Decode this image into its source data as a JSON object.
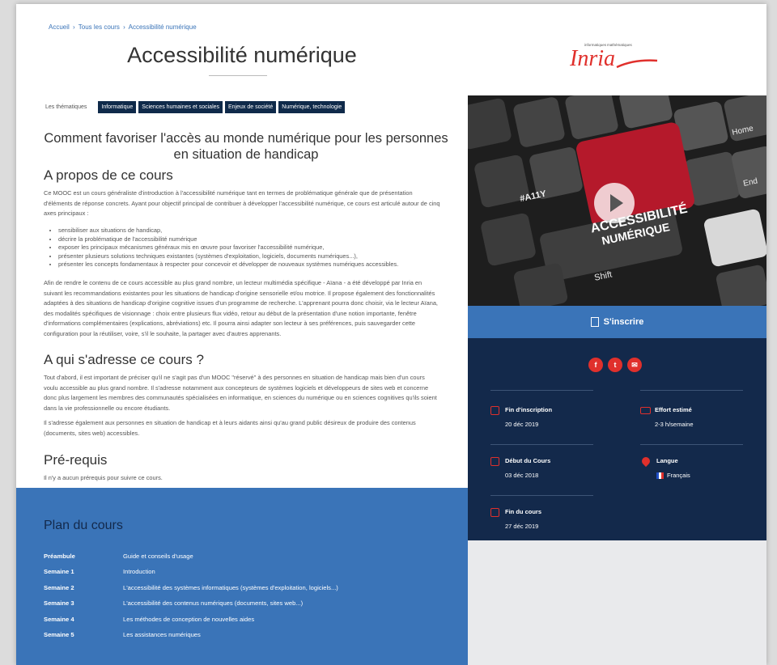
{
  "breadcrumb": {
    "home": "Accueil",
    "all_courses": "Tous les cours",
    "current": "Accessibilité numérique",
    "sep": "›"
  },
  "page_title": "Accessibilité numérique",
  "themes": {
    "label": "Les thématiques",
    "tags": [
      "Informatique",
      "Sciences humaines et sociales",
      "Enjeux de société",
      "Numérique, technologie"
    ]
  },
  "subtitle": "Comment favoriser l'accès au monde numérique pour les personnes en situation de handicap",
  "about": {
    "heading": "A propos de ce cours",
    "intro": "Ce MOOC est un cours généraliste d'introduction à l'accessibilité numérique tant en termes de problématique générale que de présentation d'éléments de réponse concrets. Ayant pour objectif principal de contribuer à développer l'accessibilité numérique, ce cours est articulé autour de cinq axes principaux :",
    "bullets": [
      "sensibiliser aux situations de handicap,",
      "décrire la problématique de l'accessibilité numérique",
      "exposer les principaux mécanismes généraux mis en œuvre pour favoriser l'accessibilité numérique,",
      "présenter plusieurs solutions techniques existantes (systèmes d'exploitation, logiciels, documents numériques...),",
      "présenter les concepts fondamentaux à respecter pour concevoir et développer de nouveaux systèmes numériques accessibles."
    ],
    "body": "Afin de rendre le contenu de ce cours accessible au plus grand nombre, un lecteur multimédia spécifique - Aïana - a été développé par Inria en suivant les recommandations existantes pour les situations de handicap d'origine sensorielle et/ou motrice. Il propose également des fonctionnalités adaptées à des situations de handicap d'origine cognitive issues d'un programme de recherche. L'apprenant pourra donc choisir, via le lecteur Aïana, des modalités spécifiques de visionnage : choix entre plusieurs flux vidéo, retour au début de la présentation d'une notion importante, fenêtre d'informations complémentaires (explications, abréviations) etc. Il pourra ainsi adapter son lecteur à ses préférences, puis sauvegarder cette configuration pour la réutiliser, voire, s'il le souhaite, la partager avec d'autres apprenants."
  },
  "audience": {
    "heading": "A qui s'adresse ce cours ?",
    "p1": "Tout d'abord, il est important de préciser qu'il ne s'agit pas d'un MOOC \"réservé\" à des personnes en situation de handicap mais bien d'un cours voulu accessible au plus grand nombre. Il s'adresse notamment aux concepteurs de systèmes logiciels et développeurs de sites web et concerne donc plus largement les membres des communautés spécialisées en informatique, en sciences du numérique ou en sciences cognitives qu'ils soient dans la vie professionnelle ou encore étudiants.",
    "p2": "Il s'adresse également aux personnes en situation de handicap et à leurs aidants ainsi qu'au grand public désireux de produire des contenus (documents, sites web) accessibles."
  },
  "prereq": {
    "heading": "Pré-requis",
    "text": "Il n'y a aucun prérequis pour suivre ce cours."
  },
  "plan": {
    "heading": "Plan du cours",
    "rows": [
      {
        "week": "Préambule",
        "title": "Guide et conseils d'usage"
      },
      {
        "week": "Semaine 1",
        "title": "Introduction"
      },
      {
        "week": "Semaine 2",
        "title": "L'accessibilité des systèmes informatiques (systèmes d'exploitation, logiciels...)"
      },
      {
        "week": "Semaine 3",
        "title": "L'accessibilité des contenus numériques (documents, sites web...)"
      },
      {
        "week": "Semaine 4",
        "title": "Les méthodes de conception de nouvelles aides"
      },
      {
        "week": "Semaine 5",
        "title": "Les assistances numériques"
      }
    ]
  },
  "sidebar": {
    "logo": {
      "top_left": "informatiques",
      "top_right": "mathématiques",
      "wordmark": "Inria"
    },
    "video": {
      "keycap_text_1": "ACCESSIBILITÉ",
      "keycap_text_2": "NUMÉRIQUE",
      "key_a11y": "#A11Y",
      "key_home": "Home",
      "key_end": "End",
      "key_shift": "Shift"
    },
    "enroll_label": "S'inscrire",
    "socials": [
      "f",
      "t",
      "✉"
    ],
    "info": {
      "end_registration": {
        "label": "Fin d'inscription",
        "value": "20 déc 2019"
      },
      "effort": {
        "label": "Effort estimé",
        "value": "2-3 h/semaine"
      },
      "course_start": {
        "label": "Début du Cours",
        "value": "03 déc 2018"
      },
      "language": {
        "label": "Langue",
        "value": "Français"
      },
      "course_end": {
        "label": "Fin du cours",
        "value": "27 déc 2019"
      }
    },
    "colors": {
      "accent": "#3a74b8",
      "navy": "#13294b",
      "red": "#e0302c"
    }
  }
}
